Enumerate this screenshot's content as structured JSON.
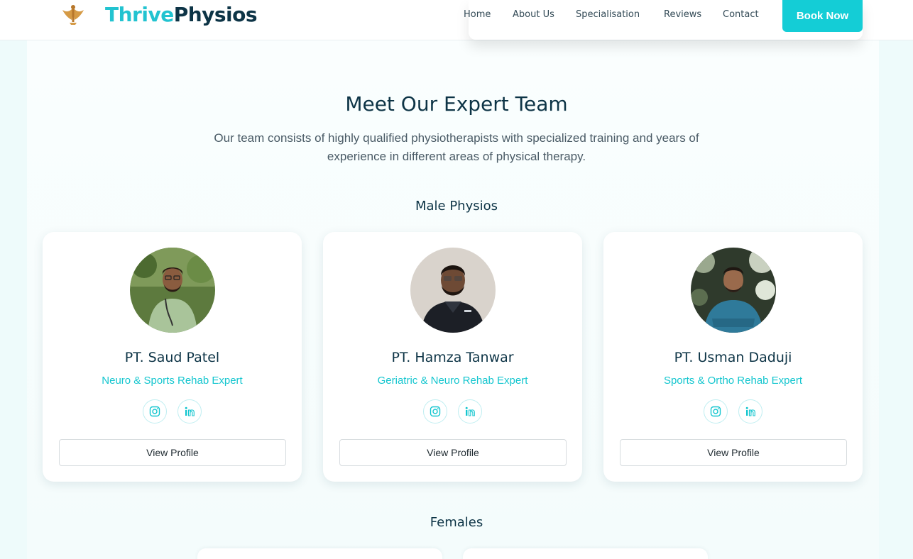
{
  "brand": {
    "part1": "Thrive",
    "part2": "Physios",
    "accent": "#22c3d0",
    "dark": "#0d3446"
  },
  "nav": {
    "items": [
      "Home",
      "About Us",
      "Specialisation",
      "Reviews",
      "Contact"
    ],
    "cta": "Book Now",
    "cta_color": "#14cdd6"
  },
  "hero": {
    "title": "Meet Our Expert Team",
    "subtitle_line1": "Our team consists of highly qualified physiotherapists with specialized training and years of",
    "subtitle_line2": "experience in different areas of physical therapy."
  },
  "groups": {
    "male": "Male Physios",
    "female": "Females"
  },
  "team": [
    {
      "name": "PT. Saud Patel",
      "role": "Neuro & Sports Rehab Expert",
      "button": "View Profile",
      "icons": [
        "instagram-icon",
        "linkedin-icon"
      ]
    },
    {
      "name": "PT. Hamza Tanwar",
      "role": "Geriatric & Neuro Rehab Expert",
      "button": "View Profile",
      "icons": [
        "instagram-icon",
        "linkedin-icon"
      ]
    },
    {
      "name": "PT. Usman Daduji",
      "role": "Sports & Ortho Rehab Expert",
      "button": "View Profile",
      "icons": [
        "instagram-icon",
        "linkedin-icon"
      ]
    }
  ]
}
